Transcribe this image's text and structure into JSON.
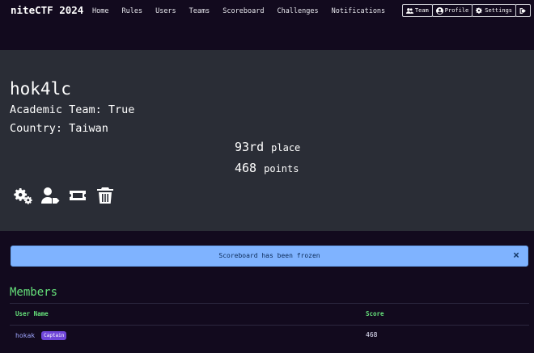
{
  "navbar": {
    "brand": "niteCTF 2024",
    "links": [
      "Home",
      "Rules",
      "Users",
      "Teams",
      "Scoreboard",
      "Challenges",
      "Notifications"
    ],
    "buttons": {
      "team": "Team",
      "profile": "Profile",
      "settings": "Settings"
    }
  },
  "team": {
    "name": "hok4lc",
    "academic": "Academic Team: True",
    "country": "Country: Taiwan",
    "place_value": "93rd",
    "place_label": "place",
    "points_value": "468",
    "points_label": "points"
  },
  "actions": [
    "settings-icon",
    "user-tag-icon",
    "ticket-icon",
    "trash-icon"
  ],
  "alert": {
    "text": "Scoreboard has been frozen",
    "close": "×"
  },
  "members": {
    "title": "Members",
    "columns": [
      "User Name",
      "Score"
    ],
    "rows": [
      {
        "user": "hokak",
        "badge": "Captain",
        "score": "468"
      }
    ]
  }
}
